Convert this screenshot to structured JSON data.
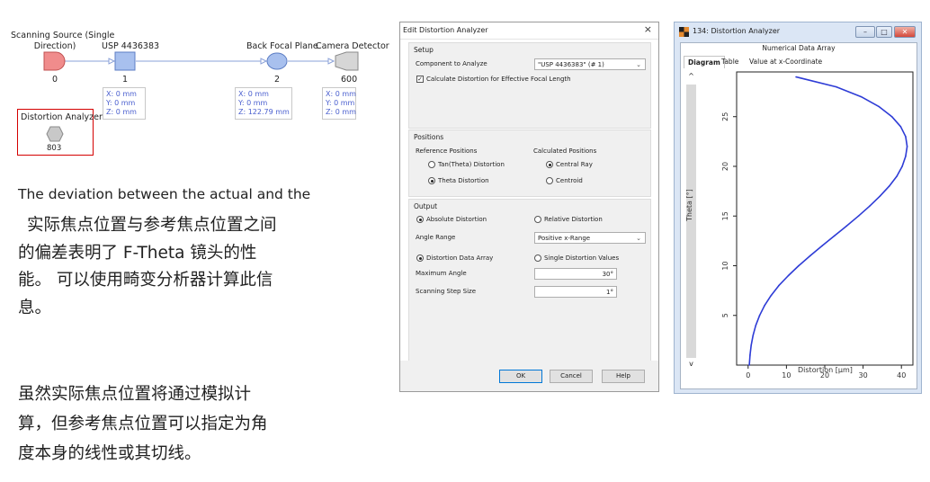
{
  "diagram": {
    "nodes": [
      {
        "label": "Scanning Source (Single\nDirection)",
        "number": "0"
      },
      {
        "label": "USP 4436383",
        "number": "1"
      },
      {
        "label": "Back Focal Plane",
        "number": "2"
      },
      {
        "label": "Camera Detector",
        "number": "600"
      },
      {
        "label": "Distortion Analyzer",
        "number": "803"
      }
    ],
    "coords": [
      [
        "X: 0 mm",
        "Y: 0 mm",
        "Z: 0 mm"
      ],
      [
        "X: 0 mm",
        "Y: 0 mm",
        "Z: 122.79 mm"
      ],
      [
        "X: 0 mm",
        "Y: 0 mm",
        "Z: 0 mm"
      ]
    ],
    "colors": {
      "source": "#f08c8c",
      "component": "#a8c0ee",
      "detector": "#c8c8c8",
      "analyzer": "#c8c8c8",
      "link": "#8aa0d8",
      "highlight": "#d40000"
    }
  },
  "text": {
    "english_line": "The deviation between the actual and the",
    "para1": [
      "实际焦点位置与参考焦点位置之间",
      "的偏差表明了 F-Theta 镜头的性",
      "能。 可以使用畸变分析器计算此信",
      "息。"
    ],
    "para2": [
      "虽然实际焦点位置将通过模拟计",
      "算，但参考焦点位置可以指定为角",
      "度本身的线性或其切线。"
    ]
  },
  "dialog": {
    "title": "Edit Distortion Analyzer",
    "close": "×",
    "setup": {
      "title": "Setup",
      "component_label": "Component to Analyze",
      "component_value": "\"USP 4436383\" (# 1)",
      "checkbox_label": "Calculate Distortion for Effective Focal Length",
      "checked": true
    },
    "positions": {
      "title": "Positions",
      "reference_header": "Reference Positions",
      "calculated_header": "Calculated Positions",
      "tan_theta": "Tan(Theta) Distortion",
      "theta": "Theta Distortion",
      "central_ray": "Central Ray",
      "centroid": "Centroid"
    },
    "output": {
      "title": "Output",
      "absolute": "Absolute Distortion",
      "relative": "Relative Distortion",
      "angle_range_label": "Angle Range",
      "angle_range_value": "Positive x-Range",
      "data_array": "Distortion Data Array",
      "single_values": "Single Distortion Values",
      "max_angle_label": "Maximum Angle",
      "max_angle_value": "30°",
      "step_label": "Scanning Step Size",
      "step_value": "1°"
    },
    "buttons": {
      "ok": "OK",
      "cancel": "Cancel",
      "help": "Help"
    }
  },
  "analyzer": {
    "title": "134: Distortion Analyzer",
    "subtitle": "Numerical Data Array",
    "tabs": [
      "Diagram",
      "Table",
      "Value at x-Coordinate"
    ],
    "scroll_up": "^",
    "scroll_down": "v"
  },
  "chart_data": {
    "type": "line",
    "xlabel": "Distortion [µm]",
    "ylabel": "Theta [°]",
    "xlim": [
      -3,
      43
    ],
    "ylim": [
      0,
      29.5
    ],
    "xticks": [
      0,
      10,
      20,
      30,
      40
    ],
    "yticks": [
      5,
      10,
      15,
      20,
      25
    ],
    "line_color": "#2e3cd6",
    "series": [
      {
        "x": [
          0.3,
          0.5,
          0.8,
          1.3,
          2.0,
          3.0,
          4.3,
          6.0,
          8.0,
          10.5,
          13.2,
          16.2,
          19.3,
          22.5,
          25.7,
          28.8,
          31.7,
          34.4,
          36.8,
          38.8,
          40.2,
          41.1,
          41.5,
          41.1,
          39.8,
          37.5,
          34.2,
          29.5,
          23.0,
          12.5
        ],
        "y": [
          0,
          1,
          2,
          3,
          4,
          5,
          6,
          7,
          8,
          9,
          10,
          11,
          12,
          13,
          14,
          15,
          16,
          17,
          18,
          19,
          20,
          21,
          22,
          23,
          24,
          25,
          26,
          27,
          28,
          29
        ]
      }
    ]
  }
}
